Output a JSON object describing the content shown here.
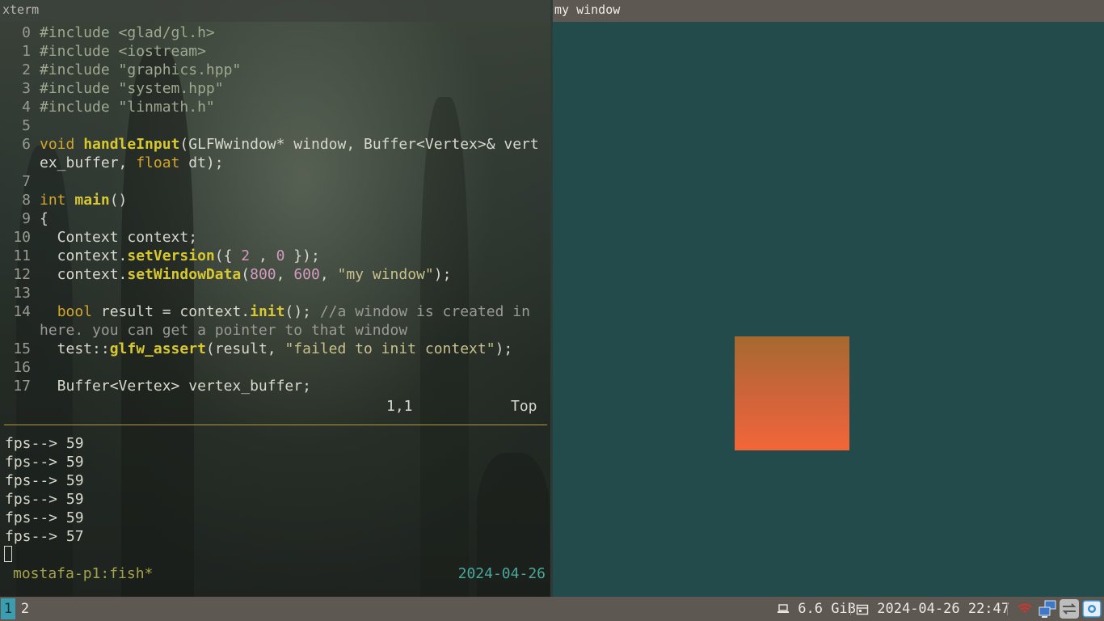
{
  "left_window": {
    "title": "xterm",
    "editor": {
      "lines": [
        {
          "num": "0",
          "segments": [
            {
              "t": "#include <glad/gl.h>",
              "c": "k-inc"
            }
          ]
        },
        {
          "num": "1",
          "segments": [
            {
              "t": "#include <iostream>",
              "c": "k-inc"
            }
          ]
        },
        {
          "num": "2",
          "segments": [
            {
              "t": "#include \"graphics.hpp\"",
              "c": "k-inc"
            }
          ]
        },
        {
          "num": "3",
          "segments": [
            {
              "t": "#include \"system.hpp\"",
              "c": "k-inc"
            }
          ]
        },
        {
          "num": "4",
          "segments": [
            {
              "t": "#include \"linmath.h\"",
              "c": "k-inc"
            }
          ]
        },
        {
          "num": "5",
          "segments": []
        },
        {
          "num": "6",
          "segments": [
            {
              "t": "void",
              "c": "k-kw"
            },
            {
              "t": " ",
              "c": "k-plain"
            },
            {
              "t": "handleInput",
              "c": "k-fn"
            },
            {
              "t": "(GLFWwindow* window, Buffer<Vertex>& vert",
              "c": "k-plain"
            }
          ]
        },
        {
          "num": "",
          "segments": [
            {
              "t": "ex_buffer, ",
              "c": "k-plain"
            },
            {
              "t": "float",
              "c": "k-kw"
            },
            {
              "t": " dt);",
              "c": "k-plain"
            }
          ]
        },
        {
          "num": "7",
          "segments": []
        },
        {
          "num": "8",
          "segments": [
            {
              "t": "int",
              "c": "k-kw"
            },
            {
              "t": " ",
              "c": "k-plain"
            },
            {
              "t": "main",
              "c": "k-fn"
            },
            {
              "t": "()",
              "c": "k-plain"
            }
          ]
        },
        {
          "num": "9",
          "segments": [
            {
              "t": "{",
              "c": "k-plain"
            }
          ]
        },
        {
          "num": "10",
          "segments": [
            {
              "t": "  Context context;",
              "c": "k-plain"
            }
          ]
        },
        {
          "num": "11",
          "segments": [
            {
              "t": "  context.",
              "c": "k-plain"
            },
            {
              "t": "setVersion",
              "c": "k-fn"
            },
            {
              "t": "({ ",
              "c": "k-plain"
            },
            {
              "t": "2",
              "c": "k-num"
            },
            {
              "t": " , ",
              "c": "k-plain"
            },
            {
              "t": "0",
              "c": "k-num"
            },
            {
              "t": " });",
              "c": "k-plain"
            }
          ]
        },
        {
          "num": "12",
          "segments": [
            {
              "t": "  context.",
              "c": "k-plain"
            },
            {
              "t": "setWindowData",
              "c": "k-fn"
            },
            {
              "t": "(",
              "c": "k-plain"
            },
            {
              "t": "800",
              "c": "k-num"
            },
            {
              "t": ", ",
              "c": "k-plain"
            },
            {
              "t": "600",
              "c": "k-num"
            },
            {
              "t": ", ",
              "c": "k-plain"
            },
            {
              "t": "\"my window\"",
              "c": "k-str"
            },
            {
              "t": ");",
              "c": "k-plain"
            }
          ]
        },
        {
          "num": "13",
          "segments": []
        },
        {
          "num": "14",
          "segments": [
            {
              "t": "  ",
              "c": "k-plain"
            },
            {
              "t": "bool",
              "c": "k-kw"
            },
            {
              "t": " result = context.",
              "c": "k-plain"
            },
            {
              "t": "init",
              "c": "k-fn"
            },
            {
              "t": "(); ",
              "c": "k-plain"
            },
            {
              "t": "//a window is created in",
              "c": "k-com"
            }
          ]
        },
        {
          "num": "",
          "segments": [
            {
              "t": "here. you can get a pointer to that window",
              "c": "k-com"
            }
          ]
        },
        {
          "num": "15",
          "segments": [
            {
              "t": "  test::",
              "c": "k-plain"
            },
            {
              "t": "glfw_assert",
              "c": "k-fn"
            },
            {
              "t": "(result, ",
              "c": "k-plain"
            },
            {
              "t": "\"failed to init context\"",
              "c": "k-str"
            },
            {
              "t": ");",
              "c": "k-plain"
            }
          ]
        },
        {
          "num": "16",
          "segments": []
        },
        {
          "num": "17",
          "segments": [
            {
              "t": "  Buffer<Vertex> vertex_buffer;",
              "c": "k-plain"
            }
          ]
        }
      ],
      "status_position": "1,1",
      "status_scroll": "Top"
    },
    "terminal": {
      "lines": [
        "fps--> 59",
        "fps--> 59",
        "fps--> 59",
        "fps--> 59",
        "fps--> 59",
        "fps--> 57"
      ]
    },
    "tmux": {
      "session": "mostafa-p1:fish*",
      "date": "2024-04-26"
    }
  },
  "right_window": {
    "title": "my window",
    "colors": {
      "background": "#244b4b",
      "quad_top": "#a6692f",
      "quad_bottom": "#f26639"
    }
  },
  "bar": {
    "workspaces": [
      {
        "label": "1",
        "active": true
      },
      {
        "label": "2",
        "active": false
      }
    ],
    "memory": "6.6 GiB",
    "datetime": "2024-04-26 22:47",
    "tray_icons": [
      "wifi-icon",
      "network-icon",
      "transfer-icon",
      "screenshot-icon"
    ]
  }
}
